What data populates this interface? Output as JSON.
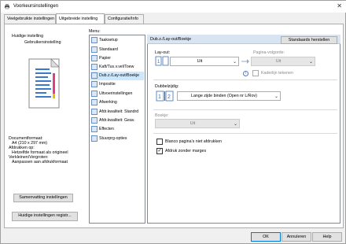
{
  "window": {
    "title": "Voorkeursinstellingen",
    "close_glyph": "✕"
  },
  "tabs": [
    {
      "label": "Veelgebruikte instellingen"
    },
    {
      "label": "Uitgebreide instelling"
    },
    {
      "label": "Configuratie/Info"
    }
  ],
  "left": {
    "profile_label": "Huidige instelling",
    "profile_name": "Gebruikersinstelling",
    "docformat_label": "Documentformaat:",
    "docformat_value": "A4 (210 x 297 mm)",
    "print_on_label": "Afdrukken op:",
    "print_on_value": "Hetzelfde formaat als origineel",
    "scale_label": "Verkleinen/Vergroten:",
    "scale_value": "Aanpassen aan afdrukformaat",
    "summary_button": "Samenvatting instellingen",
    "register_button": "Huidige instellingen registr..."
  },
  "menu": {
    "title": "Menu:",
    "items": [
      {
        "label": "Taaksetup"
      },
      {
        "label": "Standaard"
      },
      {
        "label": "Papier"
      },
      {
        "label": "Kaft/Tus.v.vel/Toew"
      },
      {
        "label": "Dub.z./Lay-out/Boekje"
      },
      {
        "label": "Impositie"
      },
      {
        "label": "Uitvoerinstellingen"
      },
      {
        "label": "Afwerking"
      },
      {
        "label": "Afdr.kwaliteit: Standrd"
      },
      {
        "label": "Afdr.kwaliteit: Geav."
      },
      {
        "label": "Effecten"
      },
      {
        "label": "Stuurprg-opties"
      }
    ]
  },
  "content": {
    "header": "Dub.z./Lay-out/Boekje",
    "restore_button": "Standaards herstellen",
    "layout_label": "Lay-out:",
    "layout_value": "Uit",
    "page_order_label": "Pagina-volgorde:",
    "page_order_value": "Uit",
    "draw_border_label": "Kaderlijn tekenen",
    "duplex_label": "Dubbelzijdig:",
    "duplex_value": "Lange zijde binden (Open nr L/Rov)",
    "booklet_label": "Boekje:",
    "booklet_value": "Uit",
    "blank_pages_label": "Blanco pagina's niet afdrukken",
    "blank_pages_checked": false,
    "no_margins_label": "Afdruk zonder marges",
    "no_margins_checked": true,
    "check_mark": "✓",
    "info_glyph": "i",
    "dropdown_glyph": "⌄"
  },
  "footer": {
    "ok": "OK",
    "cancel": "Annuleren",
    "help": "Help"
  }
}
